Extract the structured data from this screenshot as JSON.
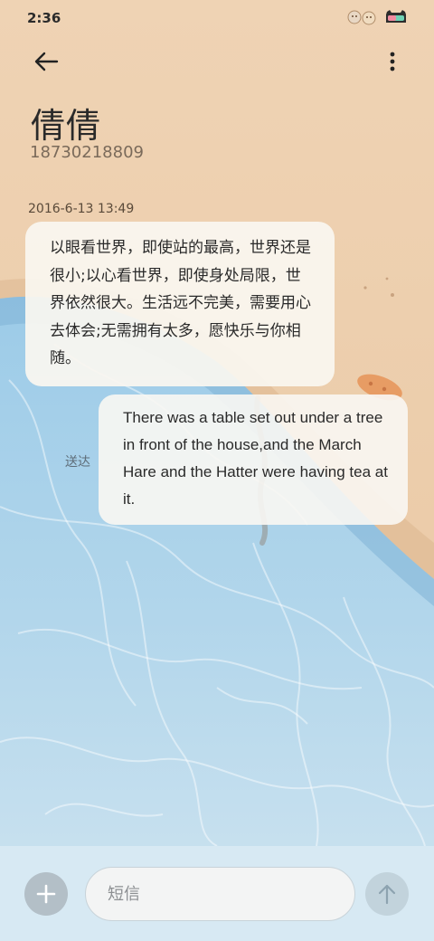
{
  "status_bar": {
    "time": "2:36"
  },
  "header": {
    "contact_name": "倩倩",
    "contact_number": "18730218809"
  },
  "conversation": {
    "timestamp": "2016-6-13 13:49",
    "messages": [
      {
        "direction": "incoming",
        "text": "以眼看世界，即使站的最高，世界还是很小;以心看世界，即使身处局限，世界依然很大。生活远不完美，需要用心去体会;无需拥有太多，愿快乐与你相随。"
      },
      {
        "direction": "outgoing",
        "text": "There was a table set out under a tree in front of the house,and the March Hare and the Hatter were having tea at it.",
        "status": "送达"
      }
    ]
  },
  "composer": {
    "placeholder": "短信"
  },
  "colors": {
    "sand": "#eecfae",
    "water": "#a9d0e8",
    "bubble": "#faf6f0",
    "composer_bar": "#d7e9f3"
  }
}
